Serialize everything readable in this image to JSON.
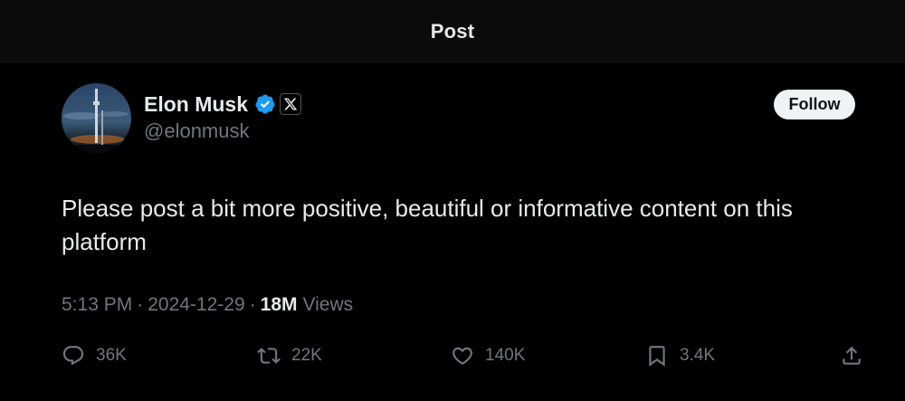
{
  "header": {
    "title": "Post"
  },
  "author": {
    "name": "Elon Musk",
    "handle": "@elonmusk",
    "verified_color": "#1d9bf0"
  },
  "follow_button": {
    "label": "Follow"
  },
  "post": {
    "text": "Please post a bit more positive, beautiful or informative content on this platform",
    "time": "5:13 PM",
    "date": "2024-12-29",
    "separator": "·",
    "views_count": "18M",
    "views_label": "Views"
  },
  "actions": {
    "replies": "36K",
    "reposts": "22K",
    "likes": "140K",
    "bookmarks": "3.4K"
  },
  "icons": [
    "verified-badge-icon",
    "x-logo-icon",
    "reply-icon",
    "repost-icon",
    "like-icon",
    "bookmark-icon",
    "share-icon"
  ]
}
